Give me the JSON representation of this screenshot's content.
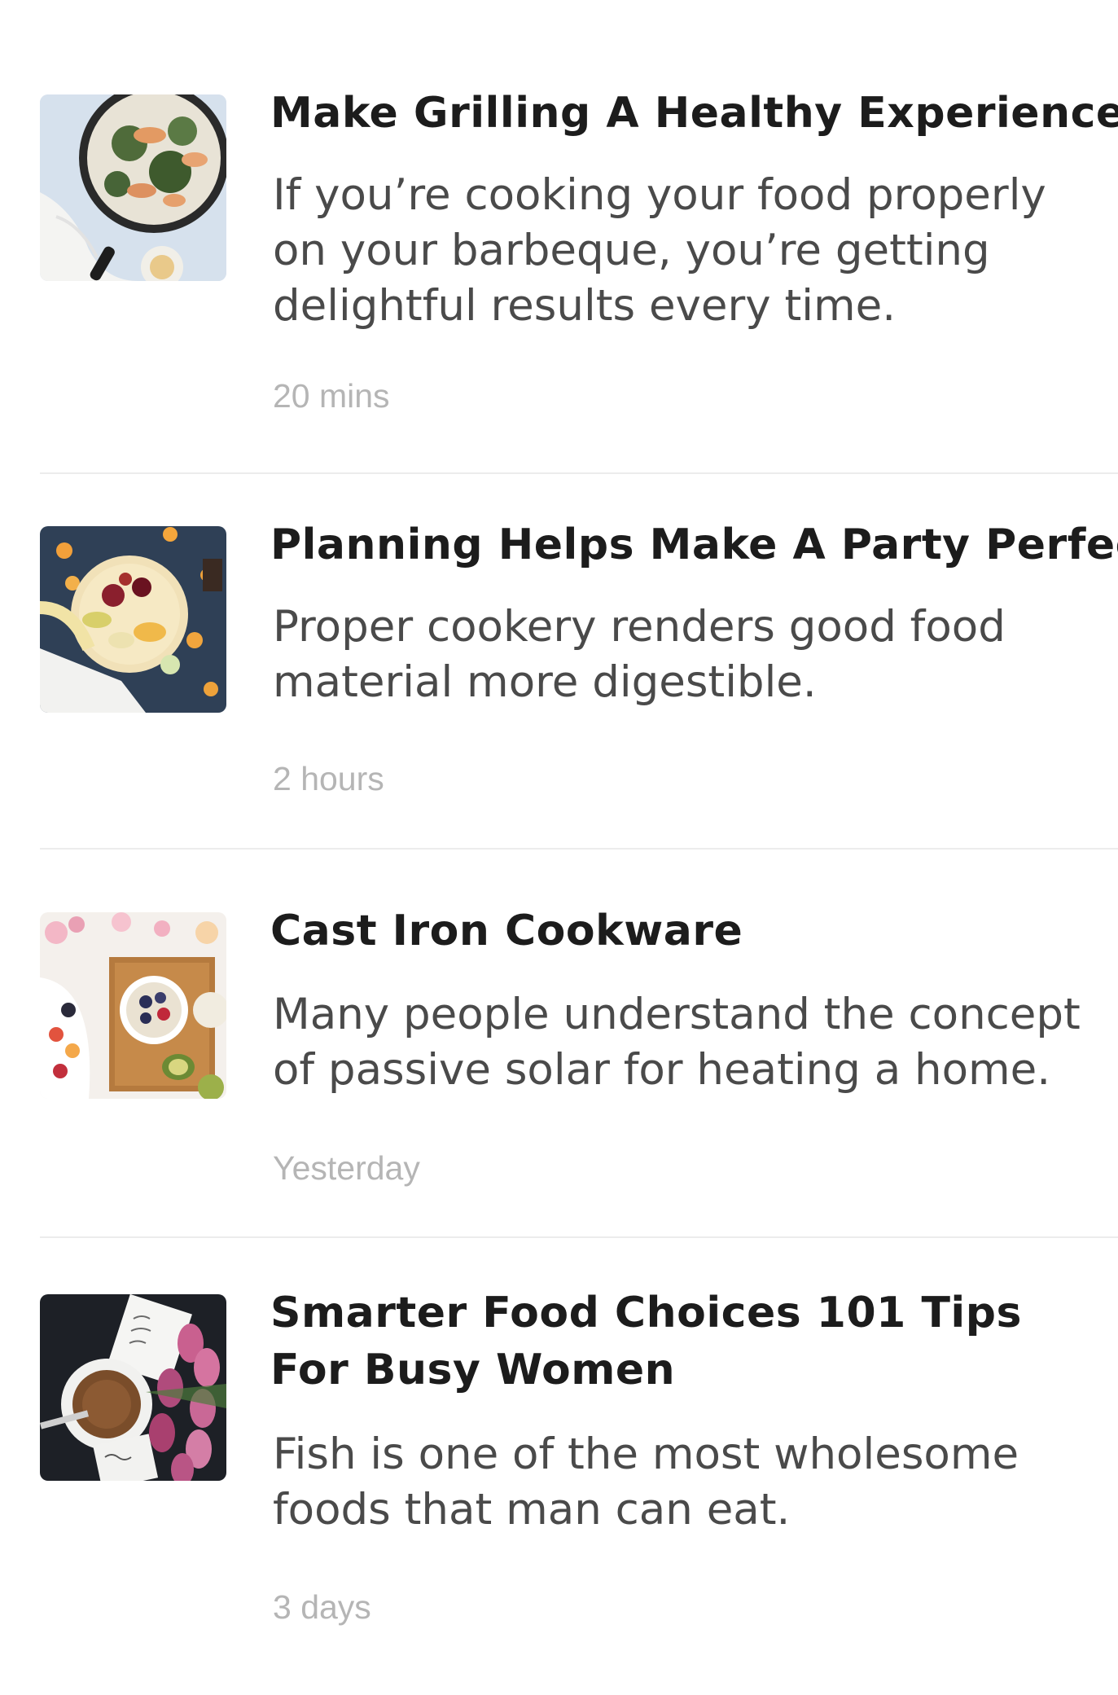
{
  "articles": [
    {
      "title": "Make Grilling A Healthy Experience",
      "excerpt": "If you’re cooking your food properly on your barbeque, you’re getting delightful results every time.",
      "time": "20 mins",
      "image": "skillet-dish-photo"
    },
    {
      "title": "Planning Helps Make A Party Perfect",
      "excerpt": "Proper cookery renders good food material more digestible.",
      "time": "2 hours",
      "image": "fruit-bowl-photo"
    },
    {
      "title": "Cast Iron Cookware",
      "excerpt": "Many people understand the concept of passive solar for heating a home.",
      "time": "Yesterday",
      "image": "breakfast-board-photo"
    },
    {
      "title": "Smarter Food Choices 101 Tips For Busy Women",
      "excerpt": "Fish is one of the most wholesome foods that man can eat.",
      "time": "3 days",
      "image": "coffee-and-tulips-photo"
    }
  ]
}
